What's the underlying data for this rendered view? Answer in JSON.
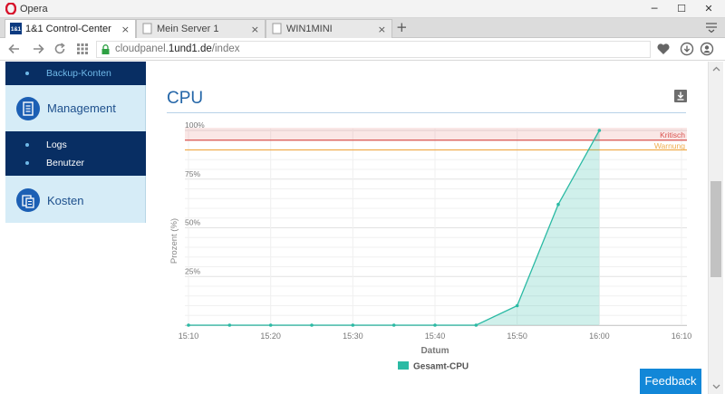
{
  "window": {
    "app_name": "Opera",
    "controls": {
      "minimize": "─",
      "maximize": "☐",
      "close": "✕"
    }
  },
  "tabs": [
    {
      "label": "1&1 Control-Center",
      "favicon_text": "1&1",
      "active": true
    },
    {
      "label": "Mein Server 1",
      "active": false
    },
    {
      "label": "WIN1MINI",
      "active": false
    }
  ],
  "tabbar": {
    "new_tab": "+",
    "tab_close": "×"
  },
  "address": {
    "url_prefix": "cloudpanel.",
    "url_domain": "1und1.de",
    "url_path": "/index"
  },
  "colors": {
    "accent": "#2466a8",
    "sidebar_dark": "#082e63",
    "sidebar_light": "#d6ecf7",
    "series": "#2bbaa4",
    "critical": "#d9534f",
    "warning": "#f0ad4e",
    "feedback": "#1287d8"
  },
  "sidebar": {
    "backup_label": "Backup-Konten",
    "management_label": "Management",
    "management_icon": "clipboard-icon",
    "sub_items": [
      {
        "label": "Logs"
      },
      {
        "label": "Benutzer"
      }
    ],
    "kosten_label": "Kosten",
    "kosten_icon": "billing-icon"
  },
  "main": {
    "title": "CPU",
    "download_icon": "download-icon",
    "feedback_label": "Feedback"
  },
  "chart_data": {
    "type": "area",
    "title": "",
    "xlabel": "Datum",
    "ylabel": "Prozent (%)",
    "x": [
      "15:10",
      "15:15",
      "15:20",
      "15:25",
      "15:30",
      "15:35",
      "15:40",
      "15:45",
      "15:50",
      "15:55",
      "16:00"
    ],
    "x_ticks": [
      "15:10",
      "15:20",
      "15:30",
      "15:40",
      "15:50",
      "16:00",
      "16:10"
    ],
    "y_ticks": [
      "25%",
      "50%",
      "75%",
      "100%"
    ],
    "ylim": [
      0,
      100
    ],
    "series": [
      {
        "name": "Gesamt-CPU",
        "values": [
          0,
          0,
          0,
          0,
          0,
          0,
          0,
          0,
          10,
          62,
          100
        ]
      }
    ],
    "thresholds": [
      {
        "label": "Kritisch",
        "value": 95,
        "color": "#d9534f"
      },
      {
        "label": "Warnung",
        "value": 90,
        "color": "#f0ad4e"
      }
    ],
    "grid": true,
    "legend": "bottom-center"
  }
}
